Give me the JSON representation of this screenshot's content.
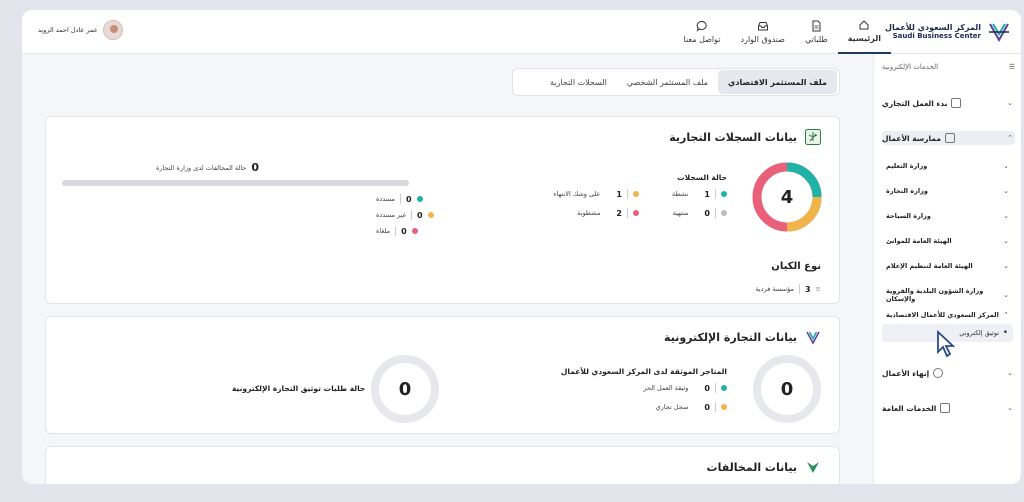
{
  "header": {
    "logo_ar": "المركز السعودي للأعمال",
    "logo_en": "Saudi Business Center",
    "nav": [
      {
        "label": "الرئيسية",
        "icon": "home-icon",
        "active": true
      },
      {
        "label": "طلباتي",
        "icon": "document-icon",
        "active": false
      },
      {
        "label": "صندوق الوارد",
        "icon": "inbox-icon",
        "active": false
      },
      {
        "label": "تواصل معنا",
        "icon": "chat-icon",
        "active": false
      }
    ],
    "user_name": "عمر عادل احمد الزويد"
  },
  "sidebar": {
    "title": "الخدمات الإلكترونية",
    "items": [
      {
        "label": "بدء العمل التجاري"
      },
      {
        "label": "ممارسة الأعمال"
      }
    ],
    "subitems": [
      {
        "label": "وزارة التعليم"
      },
      {
        "label": "وزارة التجارة"
      },
      {
        "label": "وزارة السياحة"
      },
      {
        "label": "الهيئة العامة للموانئ"
      },
      {
        "label": "الهيئة العامة لتنظيم الإعلام"
      },
      {
        "label": "وزارة الشؤون البلدية والقروية والإسكان"
      },
      {
        "label": "المركز السعودي للأعمال الاقتصادية"
      }
    ],
    "leaf": "توثيق إلكتروني",
    "bottom_items": [
      {
        "label": "إنهاء الأعمال"
      },
      {
        "label": "الخدمات العامة"
      }
    ]
  },
  "tabs": [
    {
      "label": "ملف المستثمر الاقتصادي",
      "active": true
    },
    {
      "label": "ملف المستثمر الشخصي",
      "active": false
    },
    {
      "label": "السجلات التجارية",
      "active": false
    }
  ],
  "cr_card": {
    "title": "بيانات السجلات التجارية",
    "total": "4",
    "status_title": "حالة السجلات",
    "statuses": [
      {
        "count": "1",
        "label": "نشطة",
        "color": "#20b2a6"
      },
      {
        "count": "1",
        "label": "على وشك الانتهاء",
        "color": "#f0b54a"
      },
      {
        "count": "0",
        "label": "منتهية",
        "color": "#b9bcc2"
      },
      {
        "count": "2",
        "label": "مشطوبة",
        "color": "#e9607a"
      }
    ],
    "violations_count": "0",
    "violations_title": "حالة المخالفات لدى وزارة التجارة",
    "violations": [
      {
        "count": "0",
        "label": "مسددة",
        "color": "#20b2a6"
      },
      {
        "count": "0",
        "label": "غير مسددة",
        "color": "#f0b54a"
      },
      {
        "count": "0",
        "label": "ملغاة",
        "color": "#e9607a"
      }
    ],
    "entity_title": "نوع الكيان",
    "entity_count": "3",
    "entity_label": "مؤسسة فردية"
  },
  "ecom_card": {
    "title": "بيانات التجارة الإلكترونية",
    "stores_total": "0",
    "stores_title": "المتاجر الموثقة لدى المركز السعودي للأعمال",
    "stores": [
      {
        "count": "0",
        "label": "وثيقة العمل الحر",
        "color": "#20b2a6"
      },
      {
        "count": "0",
        "label": "سجل تجاري",
        "color": "#f0b54a"
      }
    ],
    "requests_total": "0",
    "requests_title": "حالة طلبات توثيق التجارة الإلكترونية"
  },
  "violations_card": {
    "title": "بيانات المخالفات"
  }
}
